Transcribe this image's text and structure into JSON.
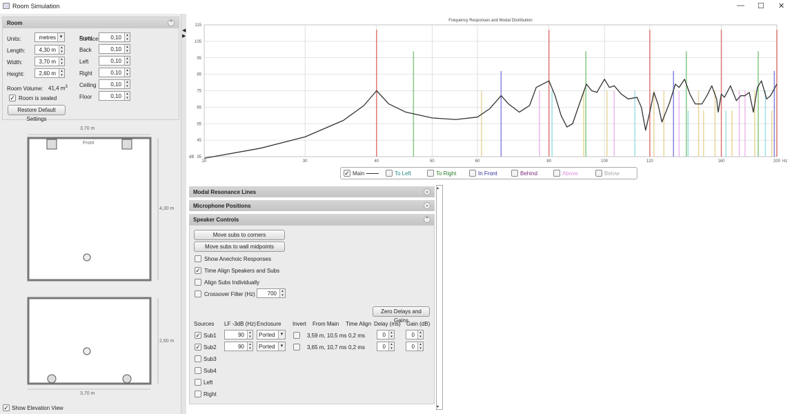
{
  "window": {
    "title": "Room Simulation",
    "minimize": "—",
    "maximize": "☐",
    "close": "✕"
  },
  "room": {
    "header": "Room",
    "units_label": "Units:",
    "units_value": "metres",
    "length_label": "Length:",
    "length": "4,30 m",
    "width_label": "Width:",
    "width": "3,70 m",
    "height_label": "Height:",
    "height": "2,60 m",
    "volume_label": "Room Volume:",
    "volume": "41,4 m",
    "volume_sup": "3",
    "sealed_label": "Room is sealed",
    "sealed": true,
    "restore_label": "Restore Default Settings",
    "absorption_title": "Surface Absorptions",
    "surfaces": [
      {
        "label": "Front",
        "value": "0,10"
      },
      {
        "label": "Back",
        "value": "0,10"
      },
      {
        "label": "Left",
        "value": "0,10"
      },
      {
        "label": "Right",
        "value": "0,10"
      },
      {
        "label": "Ceiling",
        "value": "0,10"
      },
      {
        "label": "Floor",
        "value": "0,10"
      }
    ]
  },
  "plan": {
    "width_dim": "3,70 m",
    "length_dim": "4,30 m",
    "front_label": "Front",
    "elev_width_dim": "3,70 m",
    "elev_height_dim": "2,60 m"
  },
  "show_elevation": {
    "label": "Show Elevation View",
    "checked": true
  },
  "chart_data": {
    "type": "line",
    "title": "Frequency Responses and Modal Distribution",
    "xlabel": "Hz",
    "ylabel": "dB",
    "xscale": "log",
    "xlim": [
      20,
      200
    ],
    "ylim": [
      35,
      115
    ],
    "xticks": [
      20,
      30,
      40,
      50,
      60,
      80,
      100,
      120,
      160,
      200
    ],
    "yticks": [
      35,
      45,
      55,
      65,
      75,
      85,
      95,
      105,
      115
    ],
    "series": [
      {
        "name": "Main",
        "color": "#333333",
        "points": [
          [
            20,
            34
          ],
          [
            25,
            40
          ],
          [
            30,
            47
          ],
          [
            35,
            57
          ],
          [
            38,
            66
          ],
          [
            40,
            75
          ],
          [
            42,
            67
          ],
          [
            45,
            62
          ],
          [
            50,
            58.5
          ],
          [
            55,
            57.5
          ],
          [
            60,
            59
          ],
          [
            63,
            64
          ],
          [
            66,
            72
          ],
          [
            68,
            67
          ],
          [
            71,
            62
          ],
          [
            74,
            66
          ],
          [
            76,
            77
          ],
          [
            78,
            79
          ],
          [
            80,
            81
          ],
          [
            82,
            72
          ],
          [
            84,
            60
          ],
          [
            86,
            53
          ],
          [
            88,
            55
          ],
          [
            90,
            65
          ],
          [
            93,
            79
          ],
          [
            95,
            75
          ],
          [
            97,
            74
          ],
          [
            100,
            82
          ],
          [
            102,
            77
          ],
          [
            104,
            78
          ],
          [
            107,
            73
          ],
          [
            110,
            70
          ],
          [
            114,
            71
          ],
          [
            116,
            65
          ],
          [
            118,
            51
          ],
          [
            120,
            62
          ],
          [
            122,
            74
          ],
          [
            124,
            67
          ],
          [
            126,
            56
          ],
          [
            130,
            68
          ],
          [
            133,
            79
          ],
          [
            135,
            77
          ],
          [
            138,
            82
          ],
          [
            141,
            73
          ],
          [
            144,
            67
          ],
          [
            148,
            67
          ],
          [
            151,
            72
          ],
          [
            154,
            78
          ],
          [
            157,
            70
          ],
          [
            158,
            62
          ],
          [
            160,
            73
          ],
          [
            162,
            71
          ],
          [
            166,
            78
          ],
          [
            170,
            69
          ],
          [
            173,
            72
          ],
          [
            176,
            72
          ],
          [
            179,
            74
          ],
          [
            182,
            62
          ],
          [
            185,
            77
          ],
          [
            188,
            81
          ],
          [
            192,
            70
          ],
          [
            195,
            72
          ],
          [
            200,
            79
          ]
        ]
      }
    ],
    "modes": [
      [
        40,
        112,
        "#d9534f"
      ],
      [
        80,
        112,
        "#d9534f"
      ],
      [
        120,
        112,
        "#d9534f"
      ],
      [
        160,
        112,
        "#d9534f"
      ],
      [
        200,
        112,
        "#d9534f"
      ],
      [
        46.4,
        99,
        "#5cb85c"
      ],
      [
        92.8,
        99,
        "#5cb85c"
      ],
      [
        139,
        99,
        "#5cb85c"
      ],
      [
        185.6,
        99,
        "#5cb85c"
      ],
      [
        66,
        87,
        "#5b5bd6"
      ],
      [
        132,
        87,
        "#5b5bd6"
      ],
      [
        198,
        87,
        "#5b5bd6"
      ],
      [
        61,
        75,
        "#e0c97a"
      ],
      [
        77,
        75,
        "#e8a0e8"
      ],
      [
        81,
        75,
        "#7fd3d8"
      ],
      [
        89,
        35,
        "#cccccc"
      ],
      [
        92,
        75,
        "#e0c97a"
      ],
      [
        101,
        75,
        "#e0c97a"
      ],
      [
        104,
        75,
        "#e8a0e8"
      ],
      [
        113,
        75,
        "#7fd3d8"
      ],
      [
        122,
        75,
        "#e0c97a"
      ],
      [
        127,
        75,
        "#e0c97a"
      ],
      [
        135,
        75,
        "#e8a0e8"
      ],
      [
        140,
        63,
        "#7fd3d8"
      ],
      [
        146,
        75,
        "#e0c97a"
      ],
      [
        149,
        63,
        "#e0c97a"
      ],
      [
        156,
        75,
        "#e0c97a"
      ],
      [
        163,
        63,
        "#7fd3d8"
      ],
      [
        167,
        63,
        "#e0c97a"
      ],
      [
        172,
        75,
        "#e8a0e8"
      ],
      [
        176,
        75,
        "#e8a0e8"
      ],
      [
        183,
        75,
        "#e0c97a"
      ],
      [
        191,
        75,
        "#7fd3d8"
      ],
      [
        196,
        63,
        "#e0c97a"
      ]
    ],
    "legend": [
      {
        "label": "Main",
        "color": "#333333",
        "checked": true
      },
      {
        "label": "To Left",
        "color": "#2a8a8a",
        "checked": false
      },
      {
        "label": "To Right",
        "color": "#2a7a2a",
        "checked": false
      },
      {
        "label": "In Front",
        "color": "#2a2a9a",
        "checked": false
      },
      {
        "label": "Behind",
        "color": "#7a2a7a",
        "checked": false
      },
      {
        "label": "Above",
        "color": "#d890d8",
        "checked": false
      },
      {
        "label": "Below",
        "color": "#aaaaaa",
        "checked": false
      }
    ]
  },
  "sections": {
    "modal": "Modal Resonance Lines",
    "mic": "Microphone Positions",
    "speaker": "Speaker Controls"
  },
  "speaker": {
    "corners": "Move subs to corners",
    "midpoints": "Move subs to wall midpoints",
    "anechoic": "Show Anechoic Responses",
    "time_align": "Time Align Speakers and Subs",
    "align_individually": "Align Subs Individually",
    "crossover": "Crossover Filter (Hz)",
    "crossover_value": "700",
    "zero": "Zero Delays and Gains",
    "headers": [
      "Sources",
      "LF -3dB (Hz)",
      "Enclosure",
      "Invert",
      "From Main",
      "Time Align",
      "Delay (ms)",
      "Gain (dB)"
    ],
    "sources": [
      {
        "name": "Sub1",
        "checked": true,
        "lf": "90",
        "enclosure": "Ported",
        "from_main": "3,59 m, 10,5 ms",
        "time_align": "0,2 ms",
        "delay": "0",
        "gain": "0"
      },
      {
        "name": "Sub2",
        "checked": true,
        "lf": "90",
        "enclosure": "Ported",
        "from_main": "3,65 m, 10,7 ms",
        "time_align": "0,2 ms",
        "delay": "0",
        "gain": "0"
      },
      {
        "name": "Sub3",
        "checked": false
      },
      {
        "name": "Sub4",
        "checked": false
      },
      {
        "name": "Left",
        "checked": false
      },
      {
        "name": "Right",
        "checked": false
      }
    ]
  }
}
